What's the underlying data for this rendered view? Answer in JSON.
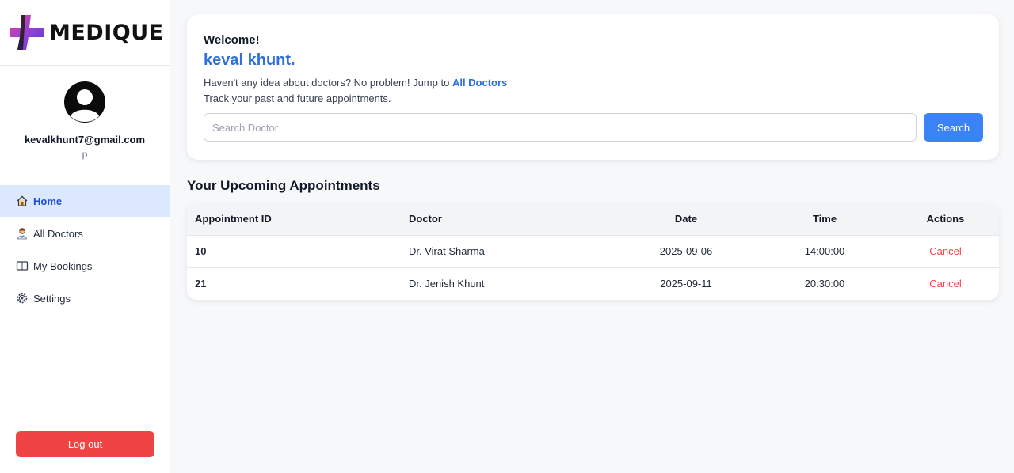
{
  "brand": {
    "name": "MEDIQUE",
    "logo_icon": "cross-logo-icon"
  },
  "profile": {
    "avatar_icon": "user-avatar-icon",
    "email": "kevalkhunt7@gmail.com",
    "subtitle": "p"
  },
  "nav": {
    "items": [
      {
        "label": "Home",
        "icon": "home-icon",
        "active": true
      },
      {
        "label": "All Doctors",
        "icon": "doctor-icon",
        "active": false
      },
      {
        "label": "My Bookings",
        "icon": "book-icon",
        "active": false
      },
      {
        "label": "Settings",
        "icon": "gear-icon",
        "active": false
      }
    ],
    "logout_label": "Log out"
  },
  "welcome": {
    "label": "Welcome!",
    "name": "keval khunt.",
    "line1_prefix": "Haven't any idea about doctors? No problem! Jump to ",
    "line1_link": "All Doctors",
    "line2": "Track your past and future appointments.",
    "search_placeholder": "Search Doctor",
    "search_value": "",
    "search_button": "Search"
  },
  "appointments": {
    "title": "Your Upcoming Appointments",
    "columns": [
      "Appointment ID",
      "Doctor",
      "Date",
      "Time",
      "Actions"
    ],
    "rows": [
      {
        "id": "10",
        "doctor": "Dr. Virat Sharma",
        "date": "2025-09-06",
        "time": "14:00:00",
        "action": "Cancel"
      },
      {
        "id": "21",
        "doctor": "Dr. Jenish Khunt",
        "date": "2025-09-11",
        "time": "20:30:00",
        "action": "Cancel"
      }
    ]
  },
  "colors": {
    "accent": "#2f6fdc",
    "primary_button": "#3b82f6",
    "danger": "#ef4444",
    "active_nav_bg": "#dbe8fd"
  }
}
